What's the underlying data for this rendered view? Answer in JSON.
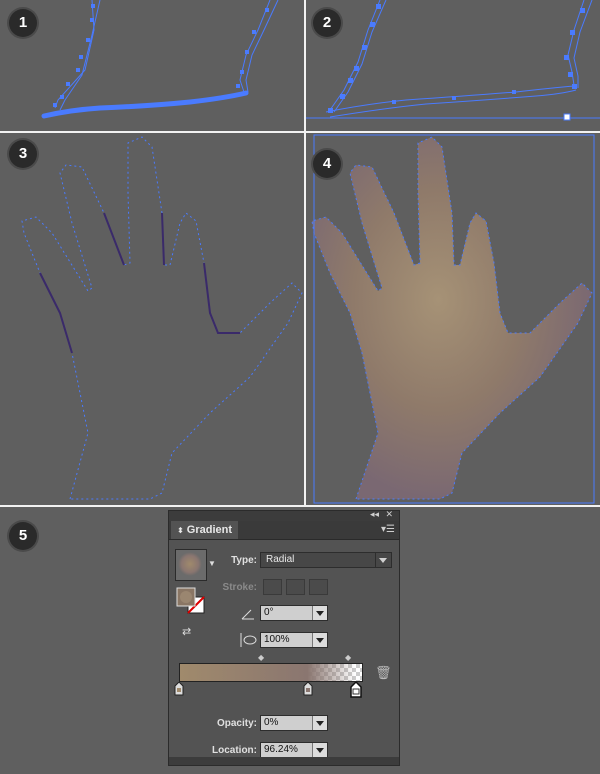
{
  "steps": {
    "s1": "1",
    "s2": "2",
    "s3": "3",
    "s4": "4",
    "s5": "5"
  },
  "colors": {
    "path_blue": "#4a7bff",
    "background": "#5f5f5f",
    "gradient_center": "#a69276",
    "gradient_mid": "#8f7a6a",
    "gradient_edge": "#7a6872"
  },
  "gradient_panel": {
    "tab_label": "Gradient",
    "type_label": "Type:",
    "type_value": "Radial",
    "stroke_label": "Stroke:",
    "angle_value": "0°",
    "aspect_value": "100%",
    "opacity_label": "Opacity:",
    "opacity_value": "0%",
    "location_label": "Location:",
    "location_value": "96.24%",
    "stops": [
      {
        "color": "#a08a6c",
        "location": 0
      },
      {
        "color": "#8a7670",
        "location": 70
      },
      {
        "color": "#ffffff",
        "location": 96.24,
        "opacity": 0
      }
    ],
    "icons": {
      "collapse": "double-chevron-icon",
      "close": "close-icon",
      "menu": "panel-menu-icon",
      "swatch_dropdown": "chevron-down-icon",
      "fill_stroke": "fill-stroke-icon",
      "reverse": "reverse-gradient-icon",
      "angle": "angle-icon",
      "aspect": "aspect-ratio-icon",
      "delete": "trash-icon"
    }
  }
}
